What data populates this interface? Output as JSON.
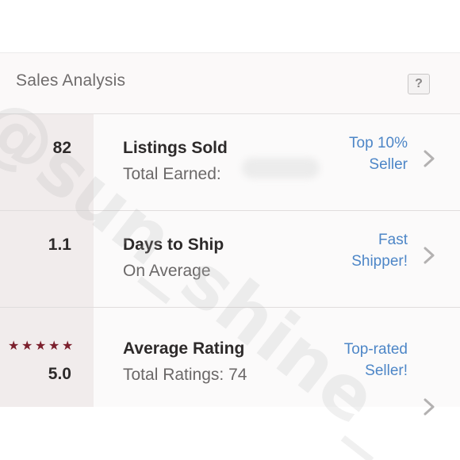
{
  "section": {
    "title": "Sales Analysis",
    "help_label": "?"
  },
  "rows": [
    {
      "metric": "82",
      "title": "Listings Sold",
      "subtitle": "Total Earned:",
      "badge_line1": "Top 10%",
      "badge_line2": "Seller"
    },
    {
      "metric": "1.1",
      "title": "Days to Ship",
      "subtitle": "On Average",
      "badge_line1": "Fast",
      "badge_line2": "Shipper!"
    },
    {
      "metric": "5.0",
      "rating_stars": 5,
      "title": "Average Rating",
      "subtitle": "Total Ratings: 74",
      "badge_line1": "Top-rated",
      "badge_line2": "Seller!"
    }
  ],
  "watermark": "@sun_shine_",
  "colors": {
    "accent_blue": "#4d86c7",
    "star_red": "#7b1f2c",
    "text_dark": "#2d2a2a",
    "text_muted": "#6b6868"
  },
  "icons": {
    "help": "question-mark-icon",
    "chevron": "chevron-right-icon",
    "star": "star-icon"
  }
}
